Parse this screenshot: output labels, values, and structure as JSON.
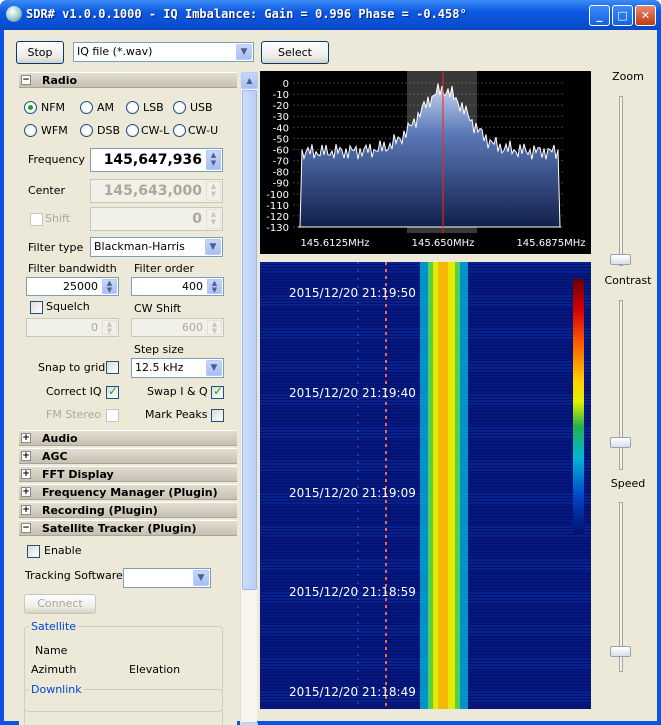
{
  "window": {
    "title": "SDR# v1.0.0.1000 - IQ Imbalance: Gain = 0.996 Phase = -0.458°",
    "minimize": "_",
    "maximize": "□",
    "close": "✕"
  },
  "toolbar": {
    "stop_label": "Stop",
    "source_value": "IQ file (*.wav)",
    "select_label": "Select"
  },
  "sections": {
    "radio": "Radio",
    "audio": "Audio",
    "agc": "AGC",
    "fft": "FFT Display",
    "freqmgr": "Frequency Manager (Plugin)",
    "recording": "Recording (Plugin)",
    "sattrack": "Satellite Tracker (Plugin)"
  },
  "radio": {
    "modes": [
      "NFM",
      "AM",
      "LSB",
      "USB",
      "WFM",
      "DSB",
      "CW-L",
      "CW-U"
    ],
    "selected_mode": "NFM",
    "frequency_label": "Frequency",
    "frequency": "145,647,936",
    "center_label": "Center",
    "center": "145,643,000",
    "shift_label": "Shift",
    "shift": "0",
    "filter_type_label": "Filter type",
    "filter_type": "Blackman-Harris",
    "filter_bw_label": "Filter bandwidth",
    "filter_bw": "25000",
    "filter_order_label": "Filter order",
    "filter_order": "400",
    "squelch_label": "Squelch",
    "squelch": "0",
    "cw_shift_label": "CW Shift",
    "cw_shift": "600",
    "step_size_label": "Step size",
    "step_size": "12.5 kHz",
    "snap_label": "Snap to grid",
    "correct_iq_label": "Correct IQ",
    "swap_iq_label": "Swap I & Q",
    "fm_stereo_label": "FM Stereo",
    "mark_peaks_label": "Mark Peaks",
    "correct_iq": true,
    "swap_iq": true,
    "snap": false,
    "fm_stereo": false,
    "mark_peaks": false,
    "squelch_on": false
  },
  "sat": {
    "enable_label": "Enable",
    "tracking_label": "Tracking Software",
    "tracking_value": "",
    "connect_label": "Connect",
    "satellite_group": "Satellite",
    "name_label": "Name",
    "azimuth_label": "Azimuth",
    "elevation_label": "Elevation",
    "downlink_group": "Downlink"
  },
  "spectrum": {
    "db_ticks": [
      "0",
      "-10",
      "-20",
      "-30",
      "-40",
      "-50",
      "-60",
      "-70",
      "-80",
      "-90",
      "-100",
      "-110",
      "-120",
      "-130"
    ],
    "freq_ticks": [
      "145.6125MHz",
      "145.650MHz",
      "145.6875MHz"
    ]
  },
  "waterfall": {
    "timestamps": [
      "2015/12/20 21:19:50",
      "2015/12/20 21:19:40",
      "2015/12/20 21:19:09",
      "2015/12/20 21:18:59",
      "2015/12/20 21:18:49"
    ]
  },
  "sliders": {
    "zoom_label": "Zoom",
    "contrast_label": "Contrast",
    "speed_label": "Speed",
    "zoom": 0.0,
    "contrast": 0.0,
    "speed": 0.0
  },
  "colors": {
    "title_bar": "#0a4fd3",
    "face": "#ece9d8",
    "spectrum_fill": "#5b79b8",
    "marker": "#ff2020",
    "waterfall_bg": "#03106e"
  }
}
